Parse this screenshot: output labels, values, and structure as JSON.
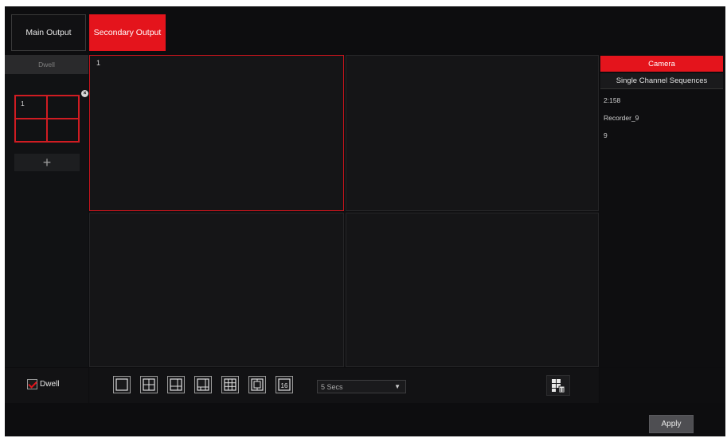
{
  "tabs": {
    "main_output": "Main Output",
    "secondary_output": "Secondary Output"
  },
  "left_panel": {
    "dwell_header": "Dwell",
    "mini_layout": {
      "cells": [
        "1",
        "",
        "",
        ""
      ]
    },
    "add_label": "+"
  },
  "view": {
    "cells": [
      {
        "label": "1",
        "selected": true
      },
      {
        "label": "",
        "selected": false
      },
      {
        "label": "",
        "selected": false
      },
      {
        "label": "",
        "selected": false
      }
    ]
  },
  "right_panel": {
    "tab_camera": "Camera",
    "tab_sequences": "Single Channel Sequences",
    "items": [
      "2:158",
      "Recorder_9",
      "9"
    ]
  },
  "bottom": {
    "dwell_checkbox_label": "Dwell",
    "dwell_checked": true,
    "layouts": [
      "1-split",
      "4-split",
      "6-split",
      "8-split",
      "9-split",
      "13-split",
      "16-split"
    ],
    "interval_value": "5 Secs"
  },
  "apply_label": "Apply",
  "colors": {
    "accent": "#e4141c",
    "background": "#0d0d0f",
    "panel": "#111214"
  }
}
